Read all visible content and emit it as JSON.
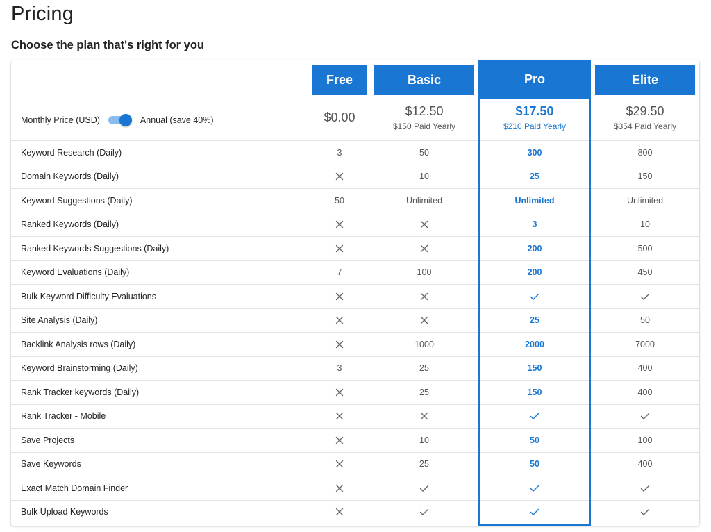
{
  "page": {
    "title": "Pricing",
    "subtitle": "Choose the plan that's right for you"
  },
  "billing": {
    "monthly_label": "Monthly Price (USD)",
    "annual_label": "Annual (save 40%)",
    "annual_selected": true
  },
  "colors": {
    "accent": "#1976d2",
    "toggle_track": "#8bbcf0",
    "text": "#222222",
    "muted": "#555555",
    "divider": "#e3e3e3"
  },
  "plans": [
    {
      "name": "Free",
      "price": "$0.00",
      "paid_yearly": ""
    },
    {
      "name": "Basic",
      "price": "$12.50",
      "paid_yearly": "$150 Paid Yearly"
    },
    {
      "name": "Pro",
      "price": "$17.50",
      "paid_yearly": "$210 Paid Yearly",
      "highlighted": true
    },
    {
      "name": "Elite",
      "price": "$29.50",
      "paid_yearly": "$354 Paid Yearly"
    }
  ],
  "features": [
    {
      "label": "Keyword Research (Daily)",
      "values": [
        "3",
        "50",
        "300",
        "800"
      ]
    },
    {
      "label": "Domain Keywords (Daily)",
      "values": [
        "x-icon",
        "10",
        "25",
        "150"
      ]
    },
    {
      "label": "Keyword Suggestions (Daily)",
      "values": [
        "50",
        "Unlimited",
        "Unlimited",
        "Unlimited"
      ]
    },
    {
      "label": "Ranked Keywords (Daily)",
      "values": [
        "x-icon",
        "x-icon",
        "3",
        "10"
      ]
    },
    {
      "label": "Ranked Keywords Suggestions (Daily)",
      "values": [
        "x-icon",
        "x-icon",
        "200",
        "500"
      ]
    },
    {
      "label": "Keyword Evaluations (Daily)",
      "values": [
        "7",
        "100",
        "200",
        "450"
      ]
    },
    {
      "label": "Bulk Keyword Difficulty Evaluations",
      "values": [
        "x-icon",
        "x-icon",
        "check-icon",
        "check-icon"
      ]
    },
    {
      "label": "Site Analysis (Daily)",
      "values": [
        "x-icon",
        "x-icon",
        "25",
        "50"
      ]
    },
    {
      "label": "Backlink Analysis rows (Daily)",
      "values": [
        "x-icon",
        "1000",
        "2000",
        "7000"
      ]
    },
    {
      "label": "Keyword Brainstorming (Daily)",
      "values": [
        "3",
        "25",
        "150",
        "400"
      ]
    },
    {
      "label": "Rank Tracker keywords (Daily)",
      "values": [
        "x-icon",
        "25",
        "150",
        "400"
      ]
    },
    {
      "label": "Rank Tracker - Mobile",
      "values": [
        "x-icon",
        "x-icon",
        "check-icon",
        "check-icon"
      ]
    },
    {
      "label": "Save Projects",
      "values": [
        "x-icon",
        "10",
        "50",
        "100"
      ]
    },
    {
      "label": "Save Keywords",
      "values": [
        "x-icon",
        "25",
        "50",
        "400"
      ]
    },
    {
      "label": "Exact Match Domain Finder",
      "values": [
        "x-icon",
        "check-icon",
        "check-icon",
        "check-icon"
      ]
    },
    {
      "label": "Bulk Upload Keywords",
      "values": [
        "x-icon",
        "check-icon",
        "check-icon",
        "check-icon"
      ]
    }
  ]
}
